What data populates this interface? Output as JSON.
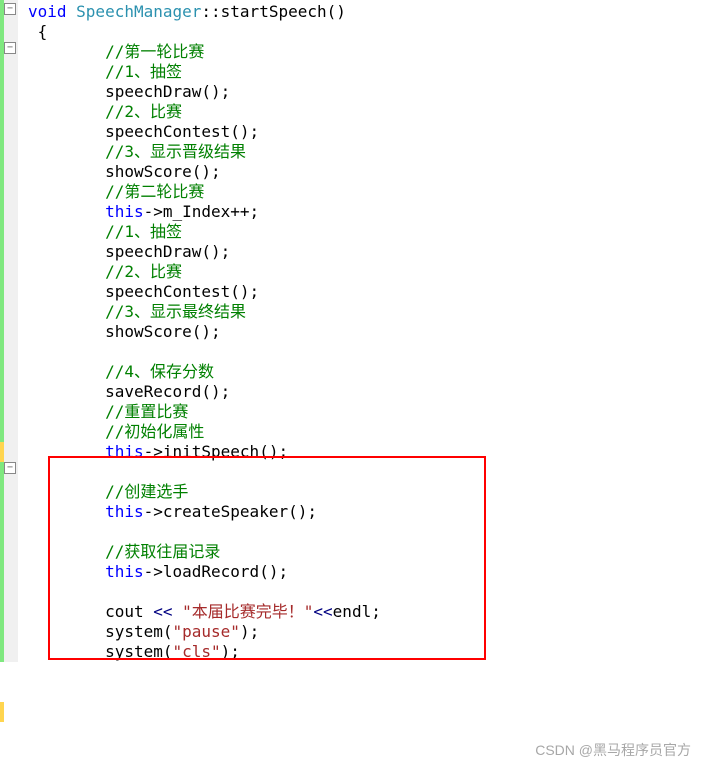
{
  "code": {
    "l1_kw": "void",
    "l1_cls": " SpeechManager",
    "l1_rest": "::startSpeech()",
    "l2": " {",
    "l3_cmt": "//第一轮比赛",
    "l4_cmt": "//1、抽签",
    "l5": "speechDraw();",
    "l6_cmt": "//2、比赛",
    "l7": "speechContest();",
    "l8_cmt": "//3、显示晋级结果",
    "l9": "showScore();",
    "l10_cmt": "//第二轮比赛",
    "l11_this": "this",
    "l11_rest": "->m_Index++;",
    "l12_cmt": "//1、抽签",
    "l13": "speechDraw();",
    "l14_cmt": "//2、比赛",
    "l15": "speechContest();",
    "l16_cmt": "//3、显示最终结果",
    "l17": "showScore();",
    "l18": "",
    "l19_cmt": "//4、保存分数",
    "l20": "saveRecord();",
    "l21_cmt": "//重置比赛",
    "l22_cmt": "//初始化属性",
    "l23_this": "this",
    "l23_rest": "->initSpeech();",
    "l24": "",
    "l25_cmt": "//创建选手",
    "l26_this": "this",
    "l26_rest": "->createSpeaker();",
    "l27": "",
    "l28_cmt": "//获取往届记录",
    "l29_this": "this",
    "l29_rest": "->loadRecord();",
    "l30": "",
    "l31_a": "cout ",
    "l31_op": "<<",
    "l31_str": " \"本届比赛完毕！\"",
    "l31_op2": "<<",
    "l31_b": "endl;",
    "l32_a": "system(",
    "l32_str": "\"pause\"",
    "l32_b": ");",
    "l33_a": "system(",
    "l33_str": "\"cls\"",
    "l33_b": ");"
  },
  "watermark": "CSDN @黑马程序员官方",
  "fold_minus": "−"
}
